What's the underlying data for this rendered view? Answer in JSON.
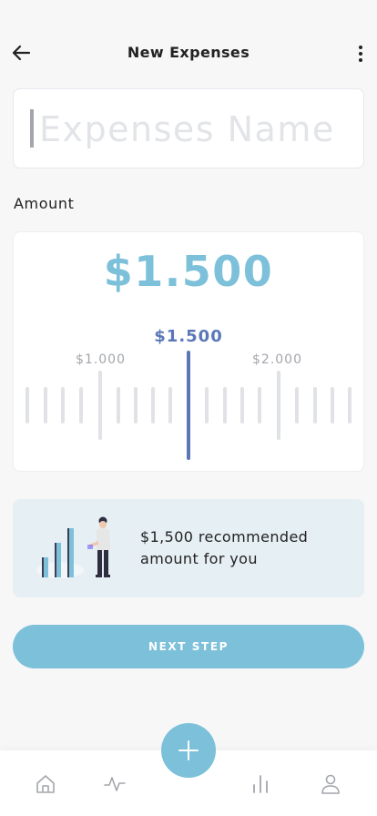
{
  "header": {
    "title": "New Expenses",
    "back_icon": "arrow-left-icon",
    "more_icon": "more-vertical-icon"
  },
  "name_input": {
    "placeholder": "Expenses Name",
    "value": ""
  },
  "amount": {
    "label": "Amount",
    "value": "$1.500",
    "ruler": {
      "current": "$1.500",
      "left_label": "$1.000",
      "right_label": "$2.000"
    }
  },
  "recommendation": {
    "text": "$1,500 recommended amount for you",
    "illustration": "person-with-bar-chart-illustration"
  },
  "next_button": {
    "label": "NEXT STEP"
  },
  "bottom_nav": {
    "items": [
      "home-icon",
      "activity-icon",
      "bar-chart-icon",
      "user-icon"
    ],
    "fab_icon": "plus-icon"
  },
  "colors": {
    "accent": "#7cc0da",
    "indicator": "#5a78b8",
    "recommendation_bg": "#e6eff4"
  }
}
